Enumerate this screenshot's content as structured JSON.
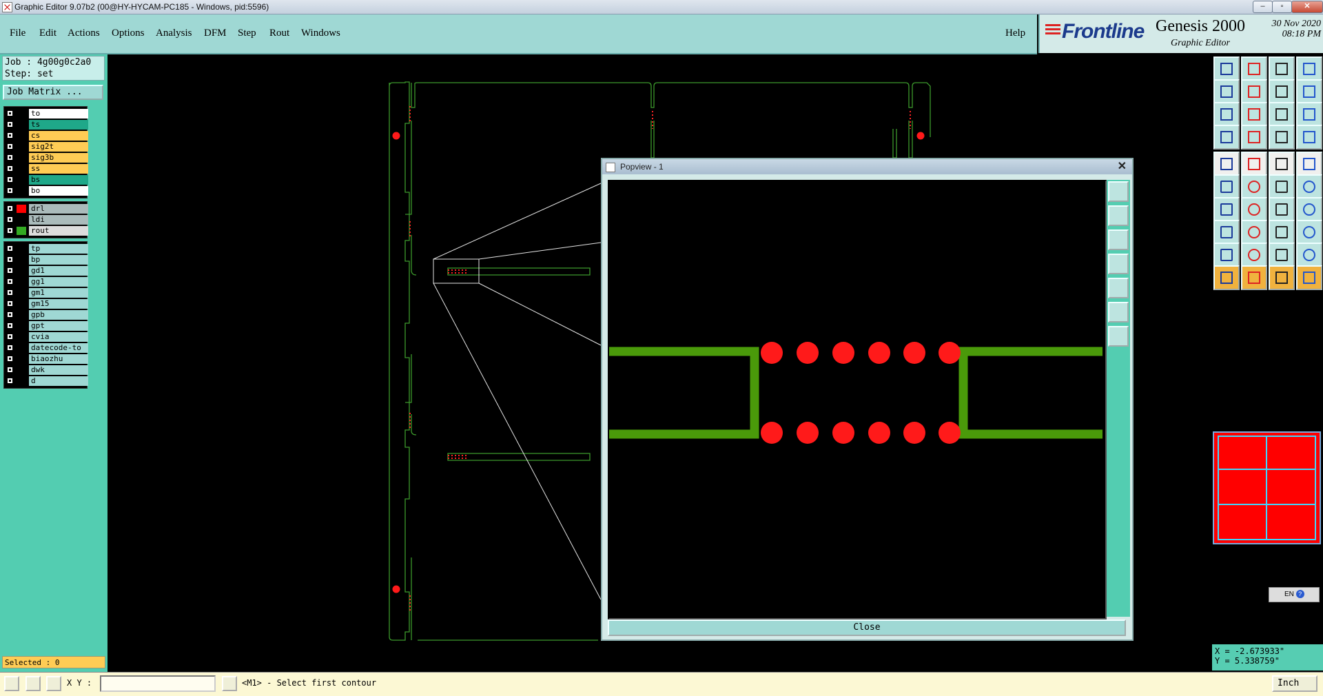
{
  "window": {
    "title": "Graphic Editor 9.07b2 (00@HY-HYCAM-PC185 - Windows, pid:5596)"
  },
  "menu": {
    "items": [
      "File",
      "Edit",
      "Actions",
      "Options",
      "Analysis",
      "DFM",
      "Step",
      "Rout",
      "Windows"
    ],
    "help": "Help"
  },
  "brand": {
    "logo": "Frontline",
    "product": "Genesis 2000",
    "subtitle": "Graphic Editor",
    "date": "30 Nov 2020",
    "time": "08:18 PM"
  },
  "job": {
    "job_line": "Job : 4g00g0c2a0",
    "step_line": "Step: set",
    "matrix_button": "Job Matrix ..."
  },
  "layers": {
    "group1": [
      {
        "name": "to",
        "color": "#ffffff"
      },
      {
        "name": "ts",
        "color": "#1fa889"
      },
      {
        "name": "cs",
        "color": "#ffcc55"
      },
      {
        "name": "sig2t",
        "color": "#ffcc55"
      },
      {
        "name": "sig3b",
        "color": "#ffcc55"
      },
      {
        "name": "ss",
        "color": "#ffcc55"
      },
      {
        "name": "bs",
        "color": "#1fa889"
      },
      {
        "name": "bo",
        "color": "#ffffff"
      }
    ],
    "group2": [
      {
        "name": "drl",
        "color": "#aabbbb",
        "swatch": "#ff0000"
      },
      {
        "name": "ldi",
        "color": "#aabbbb"
      },
      {
        "name": "rout",
        "color": "#dddddd",
        "swatch": "#33aa22"
      }
    ],
    "group3": [
      {
        "name": "tp",
        "color": "#9fd8d4"
      },
      {
        "name": "bp",
        "color": "#9fd8d4"
      },
      {
        "name": "gd1",
        "color": "#9fd8d4"
      },
      {
        "name": "gg1",
        "color": "#9fd8d4"
      },
      {
        "name": "gm1",
        "color": "#9fd8d4"
      },
      {
        "name": "gm15",
        "color": "#9fd8d4"
      },
      {
        "name": "gpb",
        "color": "#9fd8d4"
      },
      {
        "name": "gpt",
        "color": "#9fd8d4"
      },
      {
        "name": "cvia",
        "color": "#9fd8d4"
      },
      {
        "name": "datecode-to",
        "color": "#9fd8d4"
      },
      {
        "name": "biaozhu",
        "color": "#9fd8d4"
      },
      {
        "name": "dwk",
        "color": "#9fd8d4"
      },
      {
        "name": "d",
        "color": "#9fd8d4"
      }
    ]
  },
  "selected": "Selected : 0",
  "popview": {
    "title": "Popview - 1",
    "close_label": "Close"
  },
  "status": {
    "xy_label": "X Y :",
    "xy_value": "",
    "message": "<M1> - Select first contour",
    "unit": "Inch"
  },
  "coords": {
    "x": "X = -2.673933\"",
    "y": "Y = 5.338759\""
  },
  "ime": {
    "label": "EN"
  },
  "colors": {
    "background": "#000000",
    "panel": "#53cdb1",
    "menubar": "#9fd8d4",
    "outline": "#3c9a2c",
    "drill": "#ff0000",
    "trace": "#4a9a0a"
  },
  "tool_icons": [
    "zoom-fit-icon",
    "zoom-in-icon",
    "home-icon",
    "split-icon",
    "pan-left-icon",
    "pan-right-icon",
    "rotate-icon",
    "snap-icon",
    "fit-icon",
    "center-icon",
    "ratio-icon",
    "help-icon",
    "measure-icon",
    "grid-icon",
    "layer-up-icon",
    "layer-down-icon",
    "add-pad-icon",
    "add-shape-icon",
    "add-line-icon",
    "add-circle-icon",
    "connect-icon",
    "delete-icon",
    "move-icon",
    "copy-icon",
    "line-icon",
    "arc-icon",
    "undo-icon",
    "flip-icon",
    "add-point-icon",
    "cut-icon",
    "stretch-icon",
    "resize-icon",
    "triangle-icon",
    "polygon-icon",
    "slot-icon",
    "contour-icon",
    "select-icon",
    "select-single-icon",
    "select-multi-icon",
    "select-poly-icon"
  ]
}
